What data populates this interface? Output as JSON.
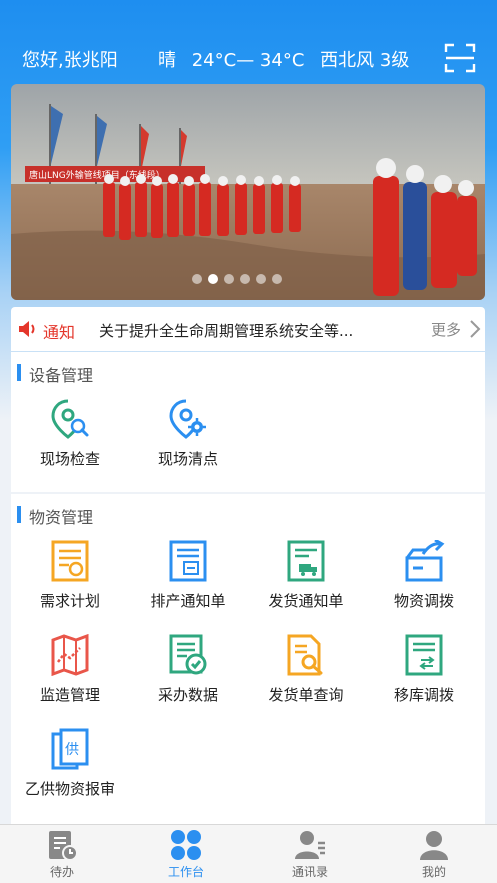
{
  "header": {
    "greeting": "您好,张兆阳",
    "weather": "晴",
    "temperature": "24°C— 34°C",
    "wind": "西北风 3级"
  },
  "banner": {
    "slide_count": 6,
    "active_index": 1,
    "sign_text": "唐山LNG外输管线项目（东线段）"
  },
  "notice": {
    "label": "通知",
    "text": "关于提升全生命周期管理系统安全等...",
    "more": "更多"
  },
  "equipment": {
    "title": "设备管理",
    "items": [
      {
        "label": "现场检查",
        "icon": "location-search-icon"
      },
      {
        "label": "现场清点",
        "icon": "location-gear-icon"
      }
    ]
  },
  "materials": {
    "title": "物资管理",
    "items": [
      {
        "label": "需求计划",
        "icon": "demand-plan-icon"
      },
      {
        "label": "排产通知单",
        "icon": "schedule-notice-icon"
      },
      {
        "label": "发货通知单",
        "icon": "shipping-notice-icon"
      },
      {
        "label": "物资调拨",
        "icon": "material-transfer-icon"
      },
      {
        "label": "监造管理",
        "icon": "supervision-map-icon"
      },
      {
        "label": "采办数据",
        "icon": "procurement-data-icon"
      },
      {
        "label": "发货单查询",
        "icon": "shipping-query-icon"
      },
      {
        "label": "移库调拨",
        "icon": "relocation-transfer-icon"
      },
      {
        "label": "乙供物资报审",
        "icon": "supplier-material-icon"
      }
    ]
  },
  "tabbar": {
    "tabs": [
      {
        "label": "待办",
        "icon": "todo-icon"
      },
      {
        "label": "工作台",
        "icon": "workbench-icon"
      },
      {
        "label": "通讯录",
        "icon": "contacts-icon"
      },
      {
        "label": "我的",
        "icon": "profile-icon"
      }
    ],
    "active": 1
  },
  "colors": {
    "accent": "#2b8ff0",
    "notice_red": "#e4362b",
    "icon_orange": "#f5a623",
    "icon_blue": "#2b8ff0",
    "icon_green": "#2fa77f",
    "icon_red": "#e9564a"
  }
}
